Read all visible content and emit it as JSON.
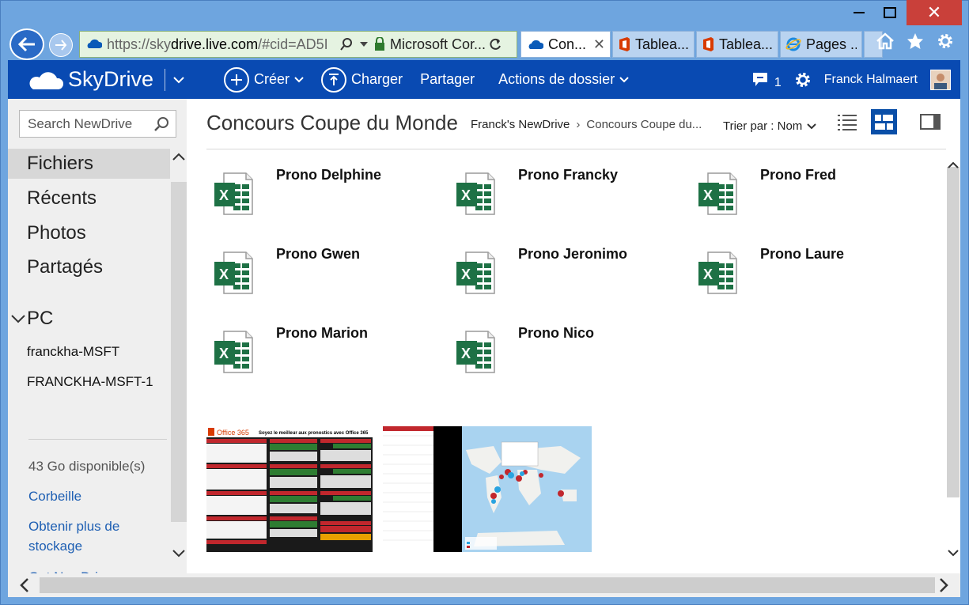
{
  "browser": {
    "url_prefix": "https://sky",
    "url_domain": "drive.live.com",
    "url_rest": "/#cid=AD5I",
    "site_name": "Microsoft Cor...",
    "tabs": [
      {
        "label": "Con...",
        "icon": "skydrive-icon",
        "active": true
      },
      {
        "label": "Tablea...",
        "icon": "office-icon",
        "active": false
      },
      {
        "label": "Tablea...",
        "icon": "office-icon",
        "active": false
      },
      {
        "label": "Pages ...",
        "icon": "ie-icon",
        "active": false
      }
    ]
  },
  "appbar": {
    "brand": "SkyDrive",
    "create": "Créer",
    "upload": "Charger",
    "share": "Partager",
    "folder_actions": "Actions de dossier",
    "notifications": "1",
    "user_name": "Franck Halmaert"
  },
  "sidebar": {
    "search_placeholder": "Search NewDrive",
    "nav": [
      "Fichiers",
      "Récents",
      "Photos",
      "Partagés"
    ],
    "pc_label": "PC",
    "pcs": [
      "franckha-MSFT",
      "FRANCKHA-MSFT-1"
    ],
    "quota": "43 Go disponible(s)",
    "recycle": "Corbeille",
    "more_storage": "Obtenir plus de stockage",
    "get_apps": "Get NewDrive apps"
  },
  "main": {
    "title": "Concours Coupe du Monde",
    "breadcrumb_root": "Franck's NewDrive",
    "breadcrumb_current": "Concours Coupe du...",
    "sort_label": "Trier par : Nom",
    "files": [
      "Prono Delphine",
      "Prono Francky",
      "Prono Fred",
      "Prono Gwen",
      "Prono Jeronimo",
      "Prono Laure",
      "Prono Marion",
      "Prono Nico"
    ],
    "thumb1_title": "Soyez le meilleur aux pronostics avec Office 365",
    "thumb1_brand": "Office 365"
  },
  "colors": {
    "appbar": "#094ab2",
    "excel_green": "#1e7145",
    "link": "#1e5fb3"
  }
}
